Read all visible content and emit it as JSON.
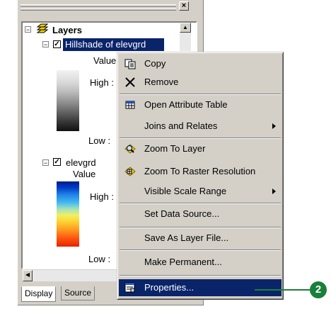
{
  "toc": {
    "root_label": "Layers",
    "layers": [
      {
        "name": "Hillshade of elevgrd",
        "value_label": "Value",
        "high_label": "High :",
        "low_label": "Low :"
      },
      {
        "name": "elevgrd",
        "value_label": "Value",
        "high_label": "High :",
        "low_label": "Low :"
      }
    ],
    "tabs": [
      "Display",
      "Source"
    ],
    "close_glyph": "×",
    "expander_glyph": "⊟",
    "check_glyph": "✓"
  },
  "context_menu": {
    "items": [
      {
        "label": "Copy",
        "icon": "copy-icon"
      },
      {
        "label": "Remove",
        "icon": "remove-icon"
      },
      {
        "label": "Open Attribute Table",
        "icon": "table-icon"
      },
      {
        "label": "Joins and Relates",
        "submenu": true
      },
      {
        "label": "Zoom To Layer",
        "icon": "zoom-to-layer-icon"
      },
      {
        "label": "Zoom To Raster Resolution",
        "icon": "zoom-raster-icon"
      },
      {
        "label": "Visible Scale Range",
        "submenu": true
      },
      {
        "label": "Set Data Source..."
      },
      {
        "label": "Save As Layer File..."
      },
      {
        "label": "Make Permanent..."
      },
      {
        "label": "Properties...",
        "icon": "properties-icon",
        "highlighted": true
      }
    ]
  },
  "callout": {
    "number": "2",
    "color": "#1a7f3a"
  },
  "colors": {
    "selection": "#0a246a",
    "face": "#d4d0c8"
  }
}
